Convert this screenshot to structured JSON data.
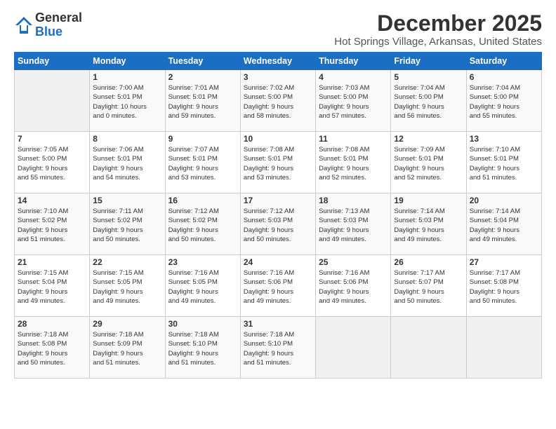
{
  "logo": {
    "line1": "General",
    "line2": "Blue"
  },
  "title": "December 2025",
  "subtitle": "Hot Springs Village, Arkansas, United States",
  "days_header": [
    "Sunday",
    "Monday",
    "Tuesday",
    "Wednesday",
    "Thursday",
    "Friday",
    "Saturday"
  ],
  "weeks": [
    [
      {
        "day": "",
        "info": ""
      },
      {
        "day": "1",
        "info": "Sunrise: 7:00 AM\nSunset: 5:01 PM\nDaylight: 10 hours\nand 0 minutes."
      },
      {
        "day": "2",
        "info": "Sunrise: 7:01 AM\nSunset: 5:01 PM\nDaylight: 9 hours\nand 59 minutes."
      },
      {
        "day": "3",
        "info": "Sunrise: 7:02 AM\nSunset: 5:00 PM\nDaylight: 9 hours\nand 58 minutes."
      },
      {
        "day": "4",
        "info": "Sunrise: 7:03 AM\nSunset: 5:00 PM\nDaylight: 9 hours\nand 57 minutes."
      },
      {
        "day": "5",
        "info": "Sunrise: 7:04 AM\nSunset: 5:00 PM\nDaylight: 9 hours\nand 56 minutes."
      },
      {
        "day": "6",
        "info": "Sunrise: 7:04 AM\nSunset: 5:00 PM\nDaylight: 9 hours\nand 55 minutes."
      }
    ],
    [
      {
        "day": "7",
        "info": "Sunrise: 7:05 AM\nSunset: 5:00 PM\nDaylight: 9 hours\nand 55 minutes."
      },
      {
        "day": "8",
        "info": "Sunrise: 7:06 AM\nSunset: 5:01 PM\nDaylight: 9 hours\nand 54 minutes."
      },
      {
        "day": "9",
        "info": "Sunrise: 7:07 AM\nSunset: 5:01 PM\nDaylight: 9 hours\nand 53 minutes."
      },
      {
        "day": "10",
        "info": "Sunrise: 7:08 AM\nSunset: 5:01 PM\nDaylight: 9 hours\nand 53 minutes."
      },
      {
        "day": "11",
        "info": "Sunrise: 7:08 AM\nSunset: 5:01 PM\nDaylight: 9 hours\nand 52 minutes."
      },
      {
        "day": "12",
        "info": "Sunrise: 7:09 AM\nSunset: 5:01 PM\nDaylight: 9 hours\nand 52 minutes."
      },
      {
        "day": "13",
        "info": "Sunrise: 7:10 AM\nSunset: 5:01 PM\nDaylight: 9 hours\nand 51 minutes."
      }
    ],
    [
      {
        "day": "14",
        "info": "Sunrise: 7:10 AM\nSunset: 5:02 PM\nDaylight: 9 hours\nand 51 minutes."
      },
      {
        "day": "15",
        "info": "Sunrise: 7:11 AM\nSunset: 5:02 PM\nDaylight: 9 hours\nand 50 minutes."
      },
      {
        "day": "16",
        "info": "Sunrise: 7:12 AM\nSunset: 5:02 PM\nDaylight: 9 hours\nand 50 minutes."
      },
      {
        "day": "17",
        "info": "Sunrise: 7:12 AM\nSunset: 5:03 PM\nDaylight: 9 hours\nand 50 minutes."
      },
      {
        "day": "18",
        "info": "Sunrise: 7:13 AM\nSunset: 5:03 PM\nDaylight: 9 hours\nand 49 minutes."
      },
      {
        "day": "19",
        "info": "Sunrise: 7:14 AM\nSunset: 5:03 PM\nDaylight: 9 hours\nand 49 minutes."
      },
      {
        "day": "20",
        "info": "Sunrise: 7:14 AM\nSunset: 5:04 PM\nDaylight: 9 hours\nand 49 minutes."
      }
    ],
    [
      {
        "day": "21",
        "info": "Sunrise: 7:15 AM\nSunset: 5:04 PM\nDaylight: 9 hours\nand 49 minutes."
      },
      {
        "day": "22",
        "info": "Sunrise: 7:15 AM\nSunset: 5:05 PM\nDaylight: 9 hours\nand 49 minutes."
      },
      {
        "day": "23",
        "info": "Sunrise: 7:16 AM\nSunset: 5:05 PM\nDaylight: 9 hours\nand 49 minutes."
      },
      {
        "day": "24",
        "info": "Sunrise: 7:16 AM\nSunset: 5:06 PM\nDaylight: 9 hours\nand 49 minutes."
      },
      {
        "day": "25",
        "info": "Sunrise: 7:16 AM\nSunset: 5:06 PM\nDaylight: 9 hours\nand 49 minutes."
      },
      {
        "day": "26",
        "info": "Sunrise: 7:17 AM\nSunset: 5:07 PM\nDaylight: 9 hours\nand 50 minutes."
      },
      {
        "day": "27",
        "info": "Sunrise: 7:17 AM\nSunset: 5:08 PM\nDaylight: 9 hours\nand 50 minutes."
      }
    ],
    [
      {
        "day": "28",
        "info": "Sunrise: 7:18 AM\nSunset: 5:08 PM\nDaylight: 9 hours\nand 50 minutes."
      },
      {
        "day": "29",
        "info": "Sunrise: 7:18 AM\nSunset: 5:09 PM\nDaylight: 9 hours\nand 51 minutes."
      },
      {
        "day": "30",
        "info": "Sunrise: 7:18 AM\nSunset: 5:10 PM\nDaylight: 9 hours\nand 51 minutes."
      },
      {
        "day": "31",
        "info": "Sunrise: 7:18 AM\nSunset: 5:10 PM\nDaylight: 9 hours\nand 51 minutes."
      },
      {
        "day": "",
        "info": ""
      },
      {
        "day": "",
        "info": ""
      },
      {
        "day": "",
        "info": ""
      }
    ]
  ]
}
